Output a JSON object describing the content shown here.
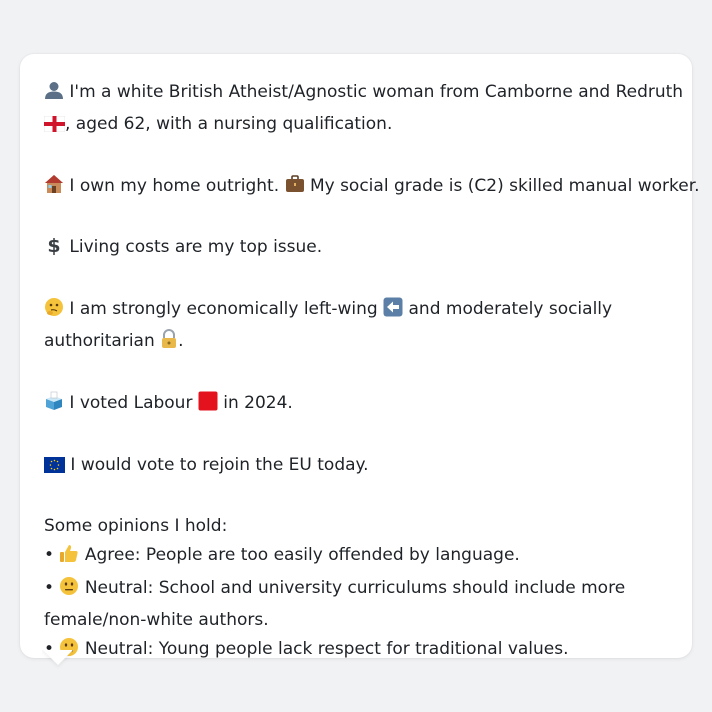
{
  "message": {
    "identity": {
      "emoji": "👤",
      "text_1": "I'm a white British Atheist/Agnostic woman from Camborne and Redruth",
      "flag": "🏴",
      "text_2": ", aged 62, with a nursing qualification."
    },
    "home": {
      "emoji": "🏠",
      "text": "I own my home outright.",
      "emoji_2": "💼",
      "text_2": "My social grade is (C2) skilled manual worker."
    },
    "issue": {
      "emoji": "💲",
      "text": "Living costs are my top issue."
    },
    "politics": {
      "emoji": "🤔",
      "text_1": "I am strongly economically left-wing",
      "left_emoji": "⬅️",
      "text_2": "and moderately socially",
      "text_3": "authoritarian",
      "lock_emoji": "🔒",
      "text_4": "."
    },
    "vote": {
      "emoji": "🗳️",
      "text_1": "I voted Labour",
      "party_emoji": "🟥",
      "text_2": "in 2024."
    },
    "eu": {
      "emoji": "🇪🇺",
      "text": "I would vote to rejoin the EU today."
    },
    "opinions": {
      "heading": "Some opinions I hold:",
      "bullet": "•",
      "items": [
        {
          "emoji": "👍",
          "text": "Agree: People are too easily offended by language."
        },
        {
          "emoji": "😐",
          "text": "Neutral: School and university curriculums should include more",
          "text_2": "female/non-white authors."
        },
        {
          "emoji": "😐",
          "text": "Neutral: Young people lack respect for traditional values."
        }
      ]
    }
  },
  "colors": {
    "background": "#f1f2f4",
    "card": "#ffffff",
    "text": "#1f2328",
    "labour_red": "#e4121d",
    "eu_blue": "#003399",
    "left_arrow_box": "#5b7fa6"
  }
}
